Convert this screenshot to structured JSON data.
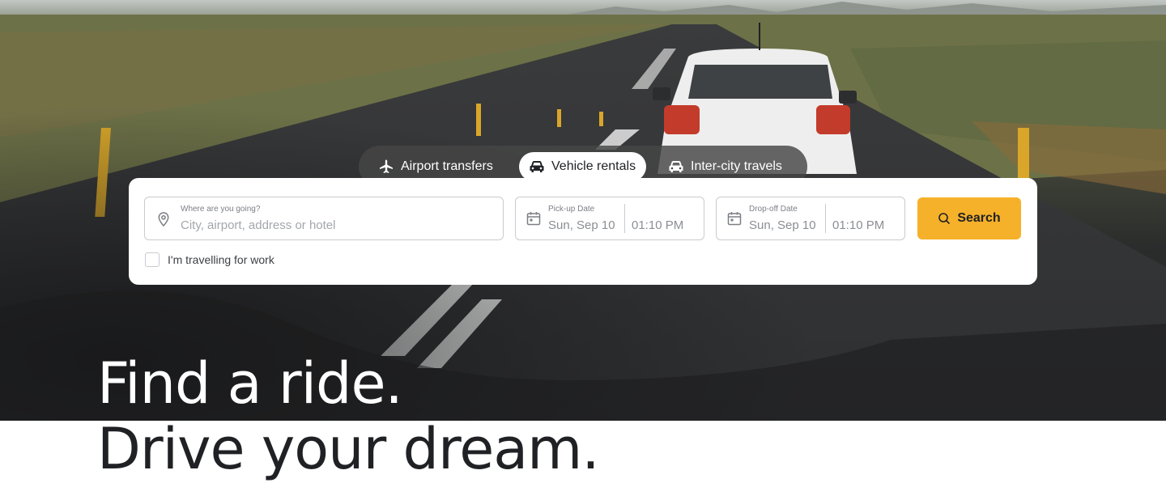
{
  "tabs": [
    {
      "label": "Airport transfers",
      "icon": "airplane-icon",
      "active": false
    },
    {
      "label": "Vehicle rentals",
      "icon": "car-icon",
      "active": true
    },
    {
      "label": "Inter-city travels",
      "icon": "car-icon",
      "active": false
    }
  ],
  "search": {
    "destination_label": "Where are you going?",
    "destination_placeholder": "City, airport, address or hotel",
    "pickup_label": "Pick-up Date",
    "pickup_date": "Sun, Sep 10",
    "pickup_time": "01:10 PM",
    "dropoff_label": "Drop-off Date",
    "dropoff_date": "Sun, Sep 10",
    "dropoff_time": "01:10 PM",
    "search_label": "Search",
    "work_label": "I'm travelling for work",
    "work_checked": false
  },
  "hero": {
    "line1": "Find a ride.",
    "line2": "Drive your dream."
  },
  "colors": {
    "accent": "#f6b12a",
    "text_dark": "#1f2124",
    "tab_bar": "#464646"
  }
}
